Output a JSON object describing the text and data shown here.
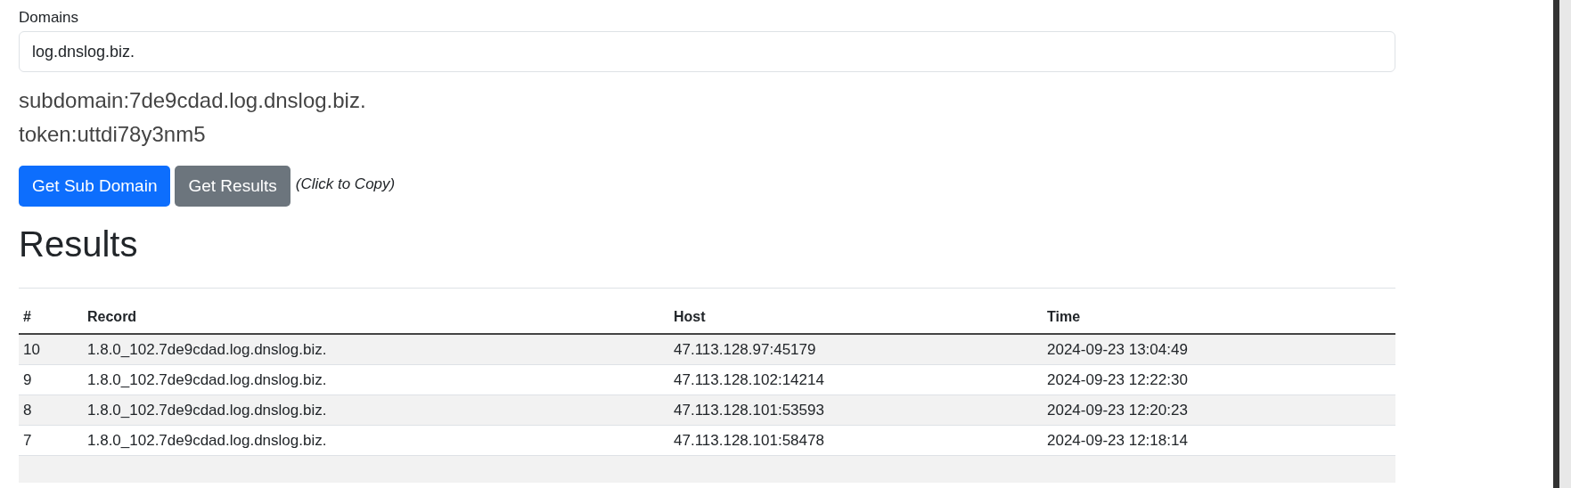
{
  "domain_field": {
    "label": "Domains",
    "value": "log.dnslog.biz."
  },
  "info": [
    "subdomain:7de9cdad.log.dnslog.biz.",
    "token:uttdi78y3nm5"
  ],
  "buttons": [
    {
      "label": "Get Sub Domain",
      "kind": "primary"
    },
    {
      "label": "Get Results",
      "kind": "secondary"
    }
  ],
  "hint": "(Click to Copy)",
  "results": {
    "title": "Results",
    "columns": [
      "#",
      "Record",
      "Host",
      "Time"
    ],
    "rows": [
      [
        "10",
        "1.8.0_102.7de9cdad.log.dnslog.biz.",
        "47.113.128.97:45179",
        "2024-09-23 13:04:49"
      ],
      [
        "9",
        "1.8.0_102.7de9cdad.log.dnslog.biz.",
        "47.113.128.102:14214",
        "2024-09-23 12:22:30"
      ],
      [
        "8",
        "1.8.0_102.7de9cdad.log.dnslog.biz.",
        "47.113.128.101:53593",
        "2024-09-23 12:20:23"
      ],
      [
        "7",
        "1.8.0_102.7de9cdad.log.dnslog.biz.",
        "47.113.128.101:58478",
        "2024-09-23 12:18:14"
      ]
    ]
  }
}
